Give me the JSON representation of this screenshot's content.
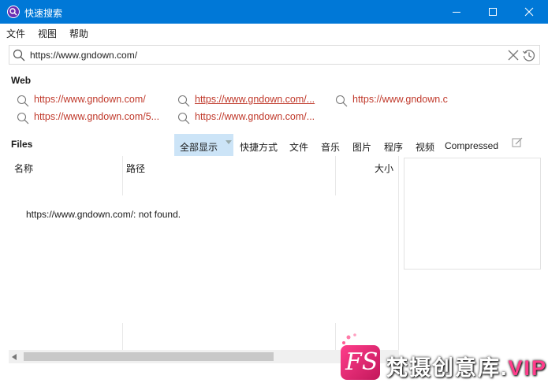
{
  "window": {
    "title": "快速搜索"
  },
  "menu": [
    "文件",
    "视图",
    "帮助"
  ],
  "search": {
    "value": "https://www.gndown.com/"
  },
  "web": {
    "title": "Web",
    "links": [
      "https://www.gndown.com/",
      "https://www.gndown.com/...",
      "https://www.gndown.c",
      "https://www.gndown.com/5...",
      "https://www.gndown.com/..."
    ]
  },
  "files": {
    "title": "Files",
    "filters": [
      "全部显示",
      "快捷方式",
      "文件",
      "音乐",
      "图片",
      "程序",
      "视频",
      "Compressed"
    ],
    "active_filter": "全部显示",
    "columns": [
      "名称",
      "路径",
      "大小"
    ],
    "message": "https://www.gndown.com/: not found."
  },
  "watermark": {
    "text": "梵摄创意库.",
    "vip": "VIP",
    "logo": "FS"
  },
  "colors": {
    "titlebar": "#0078d7",
    "link": "#c0392b",
    "active_tab": "#cce4f7"
  }
}
